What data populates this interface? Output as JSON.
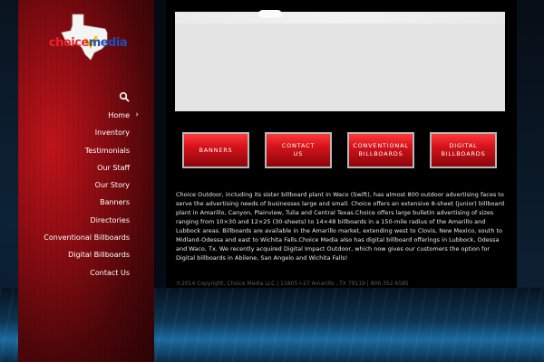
{
  "brand": {
    "logo_choice": "choice",
    "logo_media": "media",
    "colors": {
      "red": "#e6262b",
      "blue": "#1e4fb8"
    }
  },
  "nav": {
    "search_icon": "search-icon",
    "items": [
      {
        "label": "Home",
        "chevron": "›"
      },
      {
        "label": "Inventory"
      },
      {
        "label": "Testimonials"
      },
      {
        "label": "Our Staff"
      },
      {
        "label": "Our Story"
      },
      {
        "label": "Banners"
      },
      {
        "label": "Directories"
      },
      {
        "label": "Conventional Billboards"
      },
      {
        "label": "Digital Billboards"
      },
      {
        "label": "Contact Us"
      }
    ]
  },
  "buttons": [
    {
      "label": "BANNERS"
    },
    {
      "label": "CONTACT\nUS"
    },
    {
      "label": "CONVENTIONAL\nBILLBOARDS"
    },
    {
      "label": "DIGITAL\nBILLBOARDS"
    }
  ],
  "content": {
    "body": "Choice Outdoor, including its sister billboard plant in Waco (Swift), has almost 800 outdoor advertising faces to serve the advertising needs of businesses large and small. Choice offers an extensive 8-sheet (junior) billboard plant in Amarillo, Canyon, Plainview, Tulia and Central Texas.Choice offers large bulletin advertising of sizes ranging from 10×30 and 12×25 (30-sheets) to 14×48 billboards in a 150-mile radius of the Amarillo and Lubbock areas.  Billboards are available in the Amarillo market, extending west to Clovis, New Mexico, south to Midland-Odessa and east to Wichita Falls.Choice Media also has digital billboard offerings in Lubbock, Odessa and Waco, Tx. We recently acquired Digital Impact Outdoor, which now gives our customers the option for Digital billboards in Abilene, San Angelo and Wichita Falls!",
    "copyright": "©2014 Copyright, Choice Media LLC | 11805 I-27 Amarillo , TX 79119 | 806.352.6585"
  }
}
